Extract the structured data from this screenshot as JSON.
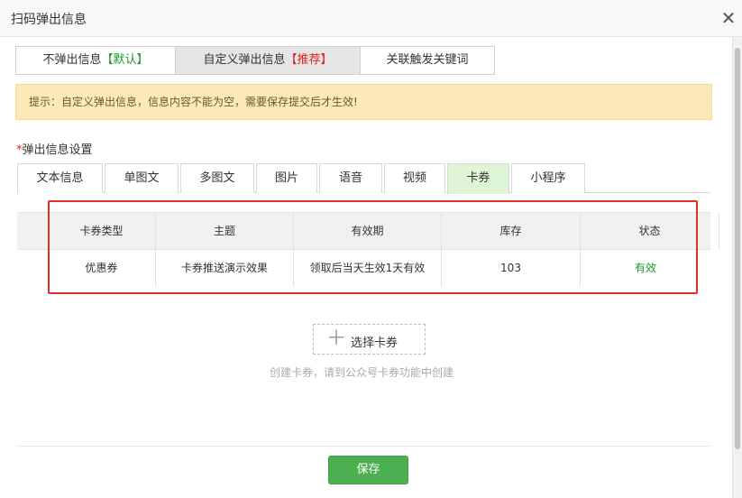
{
  "dialog": {
    "title": "扫码弹出信息",
    "close_icon": "✕"
  },
  "mode_tabs": [
    {
      "label": "不弹出信息",
      "tag": "【默认】",
      "tag_color": "green"
    },
    {
      "label": "自定义弹出信息",
      "tag": "【推荐】",
      "tag_color": "red",
      "active": true
    },
    {
      "label": "关联触发关键词",
      "tag": ""
    }
  ],
  "notice": "提示：自定义弹出信息，信息内容不能为空，需要保存提交后才生效!",
  "section": {
    "required_mark": "*",
    "label": "弹出信息设置"
  },
  "type_tabs": [
    "文本信息",
    "单图文",
    "多图文",
    "图片",
    "语音",
    "视频",
    "卡券",
    "小程序"
  ],
  "active_type_tab": "卡券",
  "table": {
    "headers": [
      "卡券类型",
      "主题",
      "有效期",
      "库存",
      "状态"
    ],
    "rows": [
      [
        "优惠券",
        "卡券推送演示效果",
        "领取后当天生效1天有效",
        "103",
        "有效"
      ]
    ]
  },
  "choose_button": {
    "icon": "plus-icon",
    "label": "选择卡券"
  },
  "hint": "创建卡券，请到公众号卡券功能中创建",
  "save_label": "保存",
  "colors": {
    "accent_green": "#4cb050",
    "highlight_red": "#e0302c",
    "notice_bg": "#fbeab7",
    "active_tab_bg": "#dff5d8"
  }
}
